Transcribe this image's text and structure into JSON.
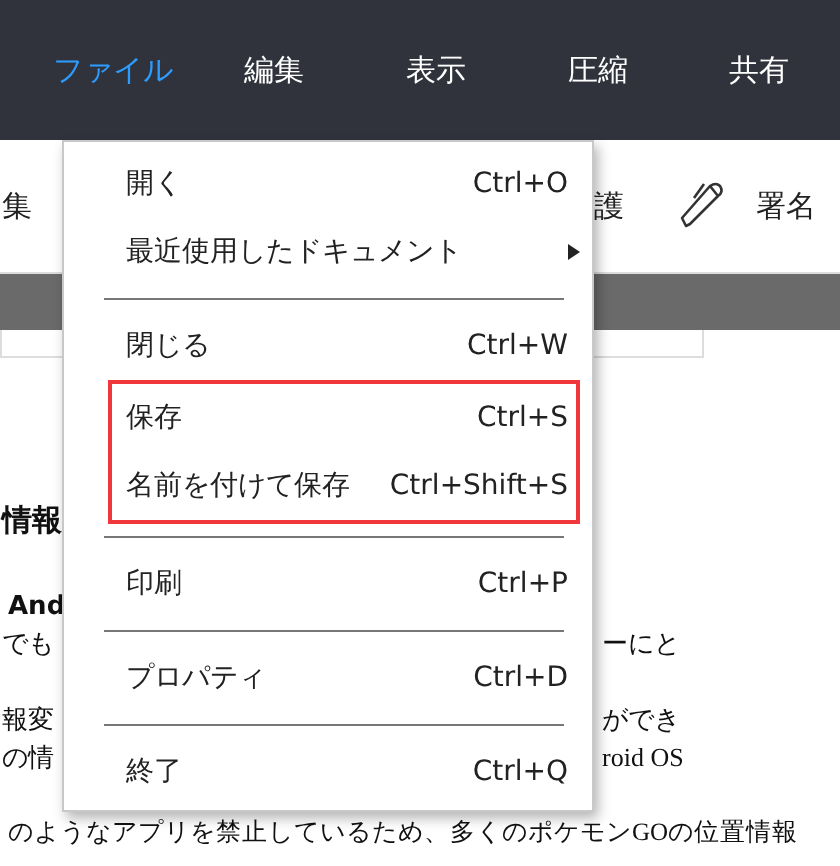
{
  "menu_bar": {
    "tabs": [
      {
        "label": "ファイル",
        "selected": true
      },
      {
        "label": "編集",
        "selected": false
      },
      {
        "label": "表示",
        "selected": false
      },
      {
        "label": "圧縮",
        "selected": false
      },
      {
        "label": "共有",
        "selected": false
      }
    ]
  },
  "toolbar": {
    "left_label": "集",
    "right_label": "護",
    "sign_label": "署名"
  },
  "document": {
    "heading": "情報",
    "subheading": "And",
    "rows": [
      {
        "left": "でも",
        "right": "ーにと"
      },
      {
        "left": "報変",
        "right": "ができ"
      },
      {
        "left": "の情",
        "right": "roid OS"
      }
    ],
    "last_line": "のようなアプリを禁止しているため、多くのポケモンGOの位置情報"
  },
  "file_menu": {
    "items": [
      {
        "kind": "item",
        "label": "開く",
        "shortcut": "Ctrl+O",
        "highlighted": false
      },
      {
        "kind": "submenu",
        "label": "最近使用したドキュメント",
        "highlighted": false
      },
      {
        "kind": "separator"
      },
      {
        "kind": "item",
        "label": "閉じる",
        "shortcut": "Ctrl+W",
        "highlighted": false
      },
      {
        "kind": "item",
        "label": "保存",
        "shortcut": "Ctrl+S",
        "highlighted": true
      },
      {
        "kind": "item",
        "label": "名前を付けて保存",
        "shortcut": "Ctrl+Shift+S",
        "highlighted": true
      },
      {
        "kind": "separator"
      },
      {
        "kind": "item",
        "label": "印刷",
        "shortcut": "Ctrl+P",
        "highlighted": false
      },
      {
        "kind": "separator"
      },
      {
        "kind": "item",
        "label": "プロパティ",
        "shortcut": "Ctrl+D",
        "highlighted": false
      },
      {
        "kind": "separator"
      },
      {
        "kind": "item",
        "label": "終了",
        "shortcut": "Ctrl+Q",
        "highlighted": false
      }
    ]
  }
}
